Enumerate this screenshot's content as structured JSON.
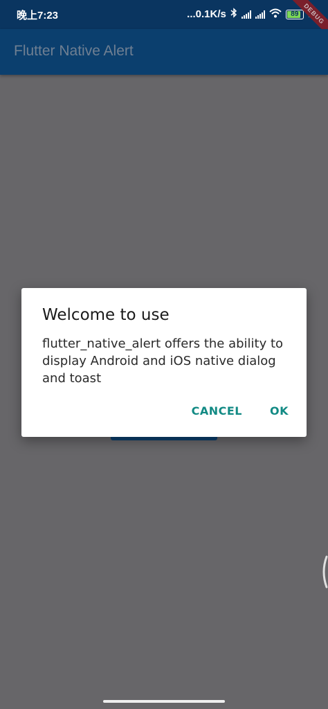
{
  "status_bar": {
    "time": "晚上7:23",
    "network_speed": "...0.1K/s",
    "bluetooth_icon": "bluetooth-icon",
    "signal_icon": "signal-icon",
    "wifi_icon": "wifi-icon",
    "battery_level": "89",
    "charging_icon": "charging-icon"
  },
  "app_bar": {
    "title": "Flutter Native Alert"
  },
  "debug_banner": {
    "label": "DEBUG"
  },
  "dialog": {
    "title": "Welcome to use",
    "message": "flutter_native_alert offers the ability to display Android and iOS native dialog and toast",
    "cancel_label": "CANCEL",
    "ok_label": "OK"
  },
  "colors": {
    "status_bar": "#0a3560",
    "app_bar": "#0b3f6e",
    "scrim": "#676669",
    "dialog_button": "#128a84"
  }
}
